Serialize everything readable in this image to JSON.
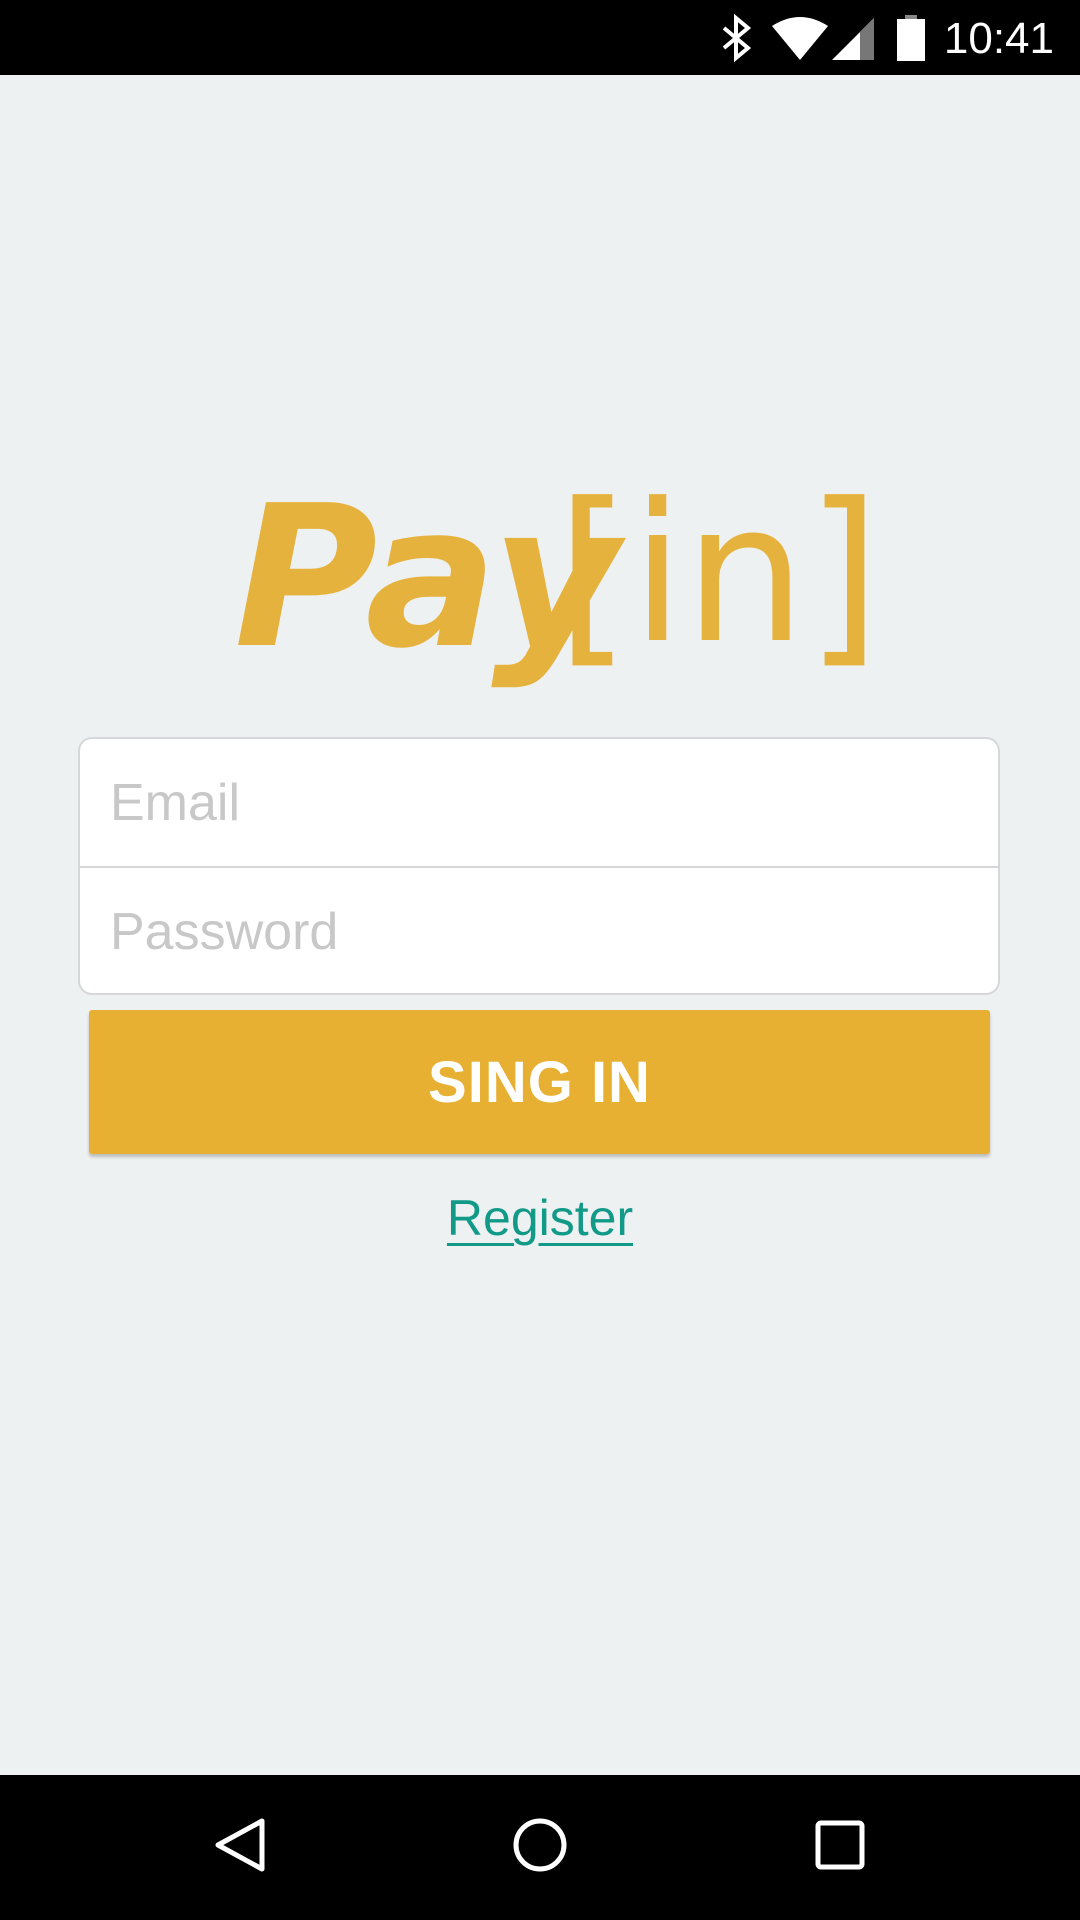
{
  "status_bar": {
    "time": "10:41",
    "icons": [
      "bluetooth-icon",
      "wifi-icon",
      "cell-signal-icon",
      "battery-icon"
    ]
  },
  "logo": {
    "text_main": "Pay",
    "text_bracket": "[in]",
    "color": "#e6b23e"
  },
  "form": {
    "email_placeholder": "Email",
    "email_value": "",
    "password_placeholder": "Password",
    "password_value": ""
  },
  "signin_button": {
    "label": "SING IN",
    "color": "#e8b032"
  },
  "register_link": {
    "label": "Register",
    "color": "#129a89"
  },
  "nav_bar": {
    "buttons": [
      "back-icon",
      "home-icon",
      "recents-icon"
    ]
  }
}
